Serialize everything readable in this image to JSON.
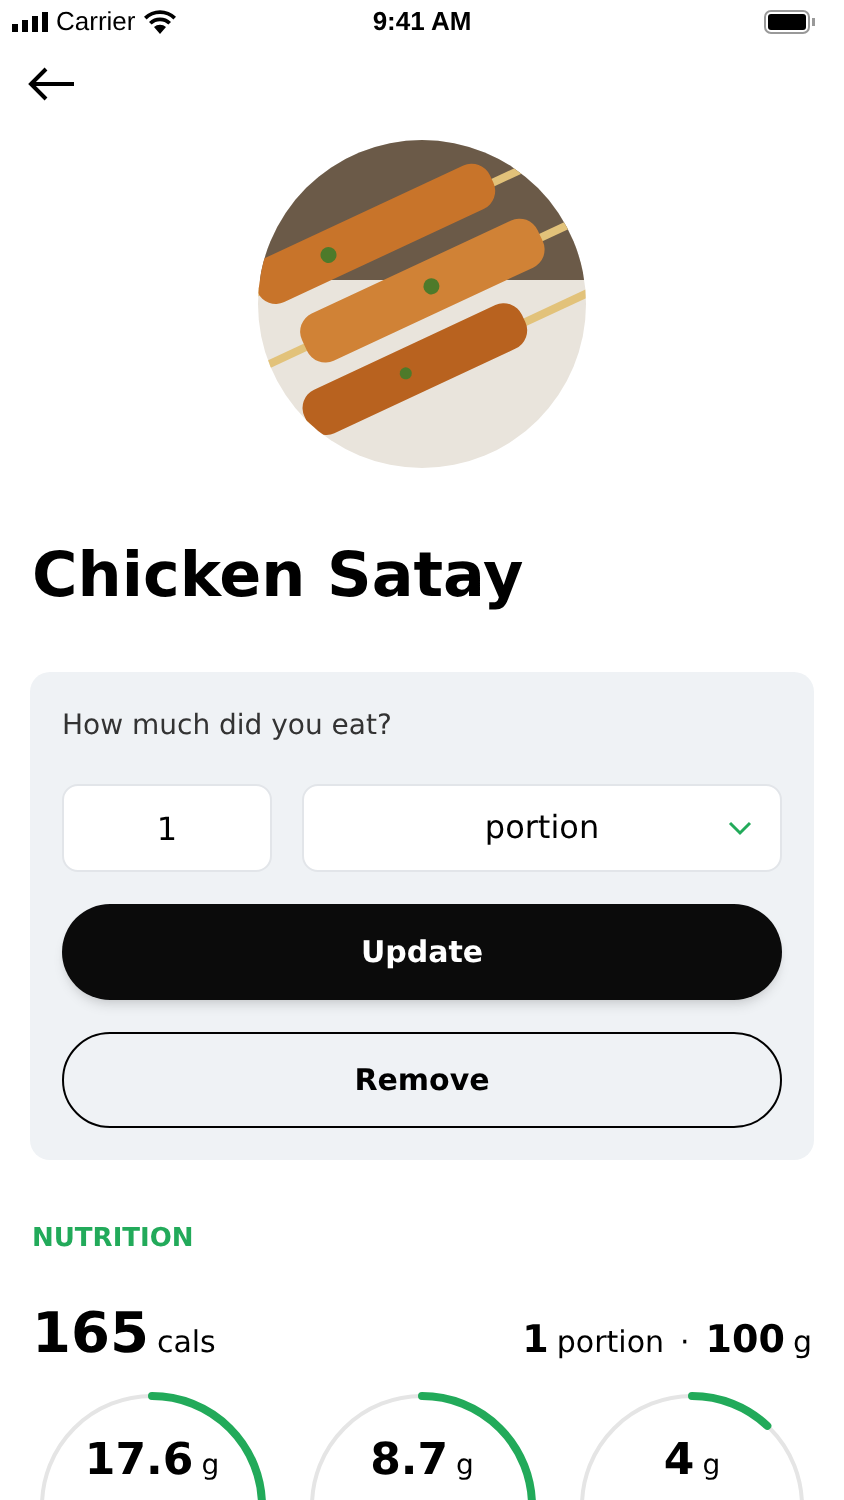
{
  "status_bar": {
    "carrier": "Carrier",
    "time": "9:41 AM"
  },
  "food": {
    "name": "Chicken Satay"
  },
  "portion_card": {
    "question": "How much did you eat?",
    "quantity": "1",
    "unit": "portion",
    "update_label": "Update",
    "remove_label": "Remove"
  },
  "nutrition": {
    "heading": "NUTRITION",
    "calories": "165",
    "calories_unit": "cals",
    "portion_count": "1",
    "portion_label": "portion",
    "separator": "·",
    "weight": "100",
    "weight_unit": "g",
    "macros": [
      {
        "amount": "17.6",
        "unit": "g",
        "level": 0.3
      },
      {
        "amount": "8.7",
        "unit": "g",
        "level": 0.3
      },
      {
        "amount": "4",
        "unit": "g",
        "level": 0.12
      }
    ]
  }
}
